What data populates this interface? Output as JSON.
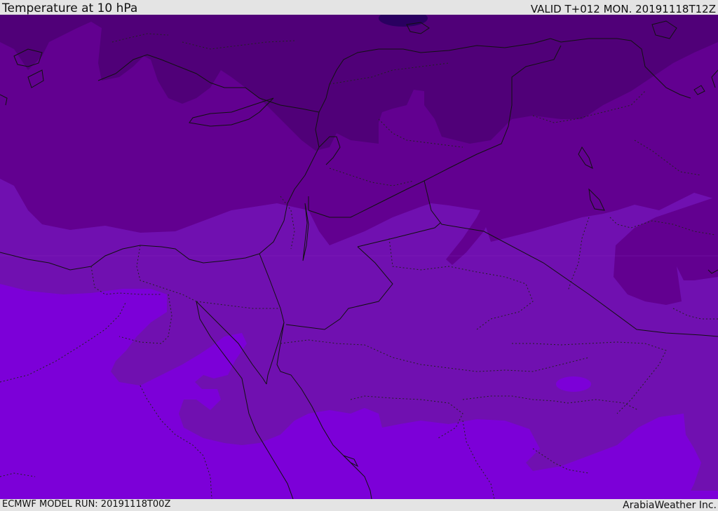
{
  "header": {
    "title": "Temperature at 10 hPa",
    "valid": "VALID T+012 MON. 20191118T12Z"
  },
  "footer": {
    "model_run": "ECMWF MODEL RUN: 20191118T00Z",
    "credit": "ArabiaWeather Inc."
  },
  "colors": {
    "coldest": "#2a0060",
    "very_cold": "#500078",
    "cold": "#620090",
    "mid": "#7010b0",
    "warm": "#7c00d8",
    "border_line": "#111111"
  }
}
